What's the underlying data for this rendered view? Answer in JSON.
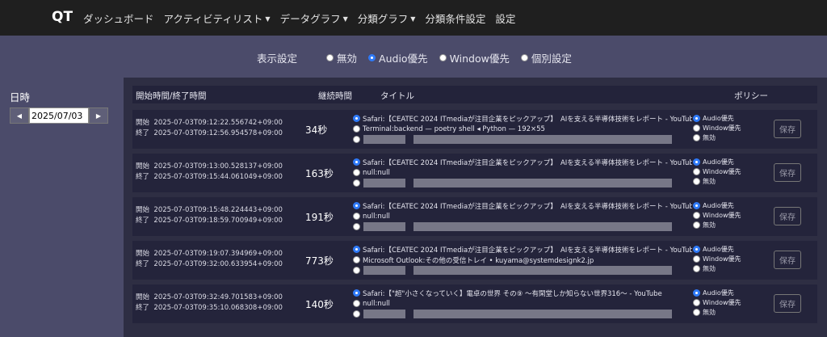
{
  "nav": {
    "brand": "QT",
    "items": [
      {
        "label": "ダッシュボード",
        "dropdown": false
      },
      {
        "label": "アクティビティリスト",
        "dropdown": true
      },
      {
        "label": "データグラフ",
        "dropdown": true
      },
      {
        "label": "分類グラフ",
        "dropdown": true
      },
      {
        "label": "分類条件設定",
        "dropdown": false
      },
      {
        "label": "設定",
        "dropdown": false
      }
    ]
  },
  "display": {
    "label": "表示設定",
    "options": [
      {
        "label": "無効",
        "selected": false
      },
      {
        "label": "Audio優先",
        "selected": true
      },
      {
        "label": "Window優先",
        "selected": false
      },
      {
        "label": "個別設定",
        "selected": false
      }
    ]
  },
  "date": {
    "label": "日時",
    "value": "2025/07/03"
  },
  "table": {
    "headers": {
      "time": "開始時間/終了時間",
      "duration": "継続時間",
      "title": "タイトル",
      "policy": "ポリシー"
    },
    "start_prefix": "開始",
    "end_prefix": "終了",
    "policy_options": [
      "Audio優先",
      "Window優先",
      "無効"
    ],
    "save_label": "保存",
    "rows": [
      {
        "start": "2025-07-03T09:12:22.556742+09:00",
        "end": "2025-07-03T09:12:56.954578+09:00",
        "duration": "34秒",
        "title1": "Safari:【CEATEC 2024 ITmediaが注目企業をピックアップ】　AIを支える半導体技術をレポート - YouTube",
        "title2": "Terminal:backend — poetry shell ◂ Python — 192×55"
      },
      {
        "start": "2025-07-03T09:13:00.528137+09:00",
        "end": "2025-07-03T09:15:44.061049+09:00",
        "duration": "163秒",
        "title1": "Safari:【CEATEC 2024 ITmediaが注目企業をピックアップ】　AIを支える半導体技術をレポート - YouTube",
        "title2": "null:null"
      },
      {
        "start": "2025-07-03T09:15:48.224443+09:00",
        "end": "2025-07-03T09:18:59.700949+09:00",
        "duration": "191秒",
        "title1": "Safari:【CEATEC 2024 ITmediaが注目企業をピックアップ】　AIを支える半導体技術をレポート - YouTube",
        "title2": "null:null"
      },
      {
        "start": "2025-07-03T09:19:07.394969+09:00",
        "end": "2025-07-03T09:32:00.633954+09:00",
        "duration": "773秒",
        "title1": "Safari:【CEATEC 2024 ITmediaが注目企業をピックアップ】　AIを支える半導体技術をレポート - YouTube",
        "title2": "Microsoft Outlook:その他の受信トレイ • kuyama@systemdesignk2.jp"
      },
      {
        "start": "2025-07-03T09:32:49.701583+09:00",
        "end": "2025-07-03T09:35:10.068308+09:00",
        "duration": "140秒",
        "title1": "Safari:【\"超\"小さくなっていく】電卓の世界 その⑨ 〜有閑堂しか知らない世界316〜 - YouTube",
        "title2": "null:null"
      }
    ]
  }
}
